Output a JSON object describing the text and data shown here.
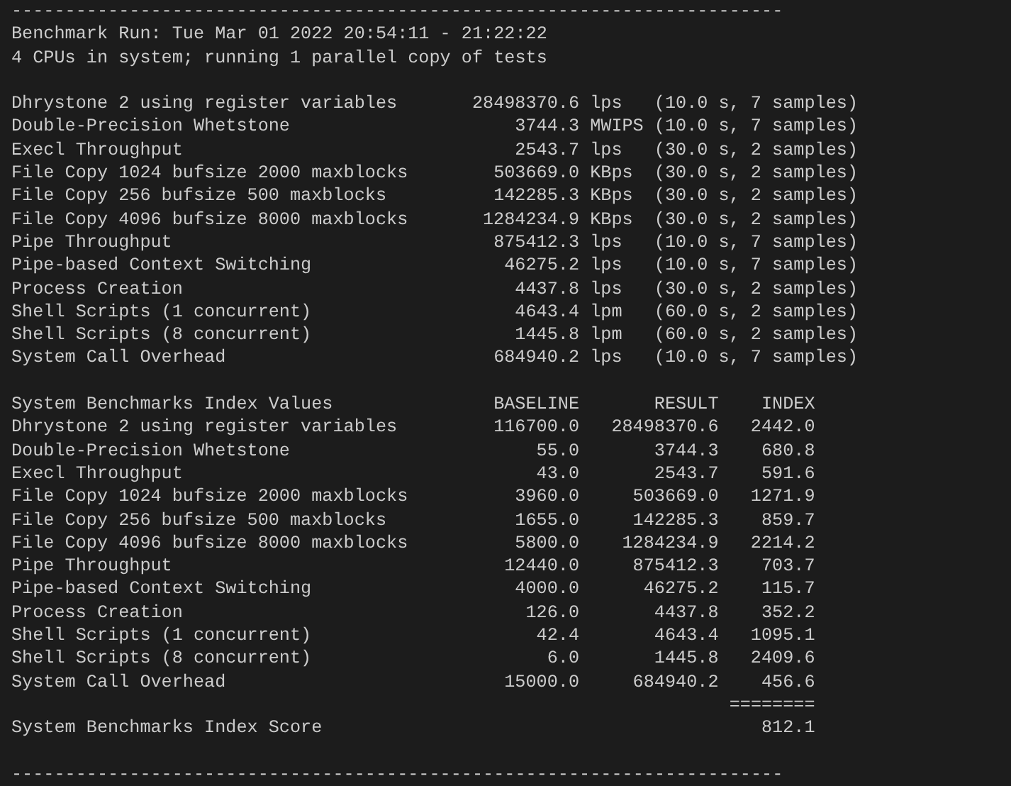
{
  "rule_top": "------------------------------------------------------------------------",
  "header": {
    "run": "Benchmark Run: Tue Mar 01 2022 20:54:11 - 21:22:22",
    "cpus": "4 CPUs in system; running 1 parallel copy of tests"
  },
  "results": [
    {
      "name": "Dhrystone 2 using register variables",
      "value": "28498370.6",
      "unit": "lps",
      "detail": "(10.0 s, 7 samples)"
    },
    {
      "name": "Double-Precision Whetstone",
      "value": "3744.3",
      "unit": "MWIPS",
      "detail": "(10.0 s, 7 samples)"
    },
    {
      "name": "Execl Throughput",
      "value": "2543.7",
      "unit": "lps",
      "detail": "(30.0 s, 2 samples)"
    },
    {
      "name": "File Copy 1024 bufsize 2000 maxblocks",
      "value": "503669.0",
      "unit": "KBps",
      "detail": "(30.0 s, 2 samples)"
    },
    {
      "name": "File Copy 256 bufsize 500 maxblocks",
      "value": "142285.3",
      "unit": "KBps",
      "detail": "(30.0 s, 2 samples)"
    },
    {
      "name": "File Copy 4096 bufsize 8000 maxblocks",
      "value": "1284234.9",
      "unit": "KBps",
      "detail": "(30.0 s, 2 samples)"
    },
    {
      "name": "Pipe Throughput",
      "value": "875412.3",
      "unit": "lps",
      "detail": "(10.0 s, 7 samples)"
    },
    {
      "name": "Pipe-based Context Switching",
      "value": "46275.2",
      "unit": "lps",
      "detail": "(10.0 s, 7 samples)"
    },
    {
      "name": "Process Creation",
      "value": "4437.8",
      "unit": "lps",
      "detail": "(30.0 s, 2 samples)"
    },
    {
      "name": "Shell Scripts (1 concurrent)",
      "value": "4643.4",
      "unit": "lpm",
      "detail": "(60.0 s, 2 samples)"
    },
    {
      "name": "Shell Scripts (8 concurrent)",
      "value": "1445.8",
      "unit": "lpm",
      "detail": "(60.0 s, 2 samples)"
    },
    {
      "name": "System Call Overhead",
      "value": "684940.2",
      "unit": "lps",
      "detail": "(10.0 s, 7 samples)"
    }
  ],
  "index_table": {
    "columns": [
      "System Benchmarks Index Values",
      "BASELINE",
      "RESULT",
      "INDEX"
    ],
    "rows": [
      {
        "name": "Dhrystone 2 using register variables",
        "baseline": "116700.0",
        "result": "28498370.6",
        "index": "2442.0"
      },
      {
        "name": "Double-Precision Whetstone",
        "baseline": "55.0",
        "result": "3744.3",
        "index": "680.8"
      },
      {
        "name": "Execl Throughput",
        "baseline": "43.0",
        "result": "2543.7",
        "index": "591.6"
      },
      {
        "name": "File Copy 1024 bufsize 2000 maxblocks",
        "baseline": "3960.0",
        "result": "503669.0",
        "index": "1271.9"
      },
      {
        "name": "File Copy 256 bufsize 500 maxblocks",
        "baseline": "1655.0",
        "result": "142285.3",
        "index": "859.7"
      },
      {
        "name": "File Copy 4096 bufsize 8000 maxblocks",
        "baseline": "5800.0",
        "result": "1284234.9",
        "index": "2214.2"
      },
      {
        "name": "Pipe Throughput",
        "baseline": "12440.0",
        "result": "875412.3",
        "index": "703.7"
      },
      {
        "name": "Pipe-based Context Switching",
        "baseline": "4000.0",
        "result": "46275.2",
        "index": "115.7"
      },
      {
        "name": "Process Creation",
        "baseline": "126.0",
        "result": "4437.8",
        "index": "352.2"
      },
      {
        "name": "Shell Scripts (1 concurrent)",
        "baseline": "42.4",
        "result": "4643.4",
        "index": "1095.1"
      },
      {
        "name": "Shell Scripts (8 concurrent)",
        "baseline": "6.0",
        "result": "1445.8",
        "index": "2409.6"
      },
      {
        "name": "System Call Overhead",
        "baseline": "15000.0",
        "result": "684940.2",
        "index": "456.6"
      }
    ],
    "total_rule": "========",
    "score_label": "System Benchmarks Index Score",
    "score": "812.1"
  },
  "rule_bottom": "------------------------------------------------------------------------"
}
